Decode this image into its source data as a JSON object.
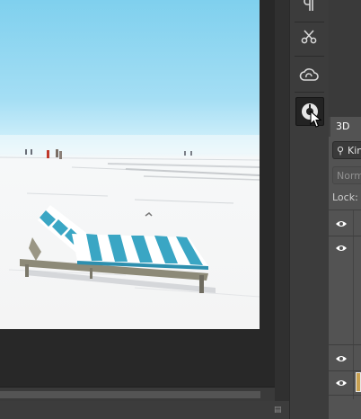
{
  "panels": {
    "tab_3d": "3D",
    "filter_kind": "Kin",
    "blend_mode": "Norm",
    "lock_label": "Lock:"
  },
  "tools": [
    "paragraph-icon",
    "tools-icon",
    "creative-cloud-icon",
    "libraries-icon"
  ],
  "layers": [
    {
      "visible": true
    },
    {
      "visible": true
    },
    {
      "visible": true
    },
    {
      "visible": true
    }
  ],
  "colors": {
    "canvas_bg": "#282828",
    "tool_panel": "#3c3c3c",
    "layers_panel": "#535353",
    "sky": "#8fd6f2",
    "chair_stripe": "#3aa6c4"
  }
}
